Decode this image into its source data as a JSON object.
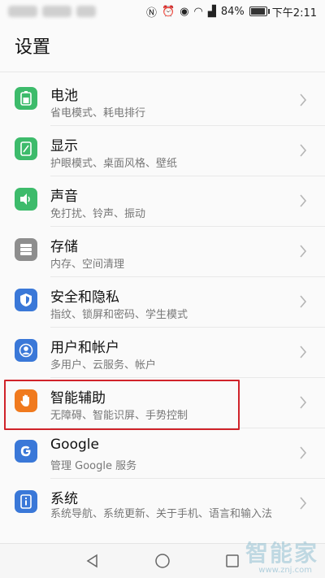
{
  "status_bar": {
    "battery_percent": "84%",
    "time": "下午2:11"
  },
  "page": {
    "title": "设置"
  },
  "items": [
    {
      "title": "电池",
      "subtitle": "省电模式、耗电排行",
      "icon": "battery-icon",
      "color": "#3dbb6b"
    },
    {
      "title": "显示",
      "subtitle": "护眼模式、桌面风格、壁纸",
      "icon": "display-icon",
      "color": "#3dbb6b"
    },
    {
      "title": "声音",
      "subtitle": "免打扰、铃声、振动",
      "icon": "speaker-icon",
      "color": "#3dbb6b"
    },
    {
      "title": "存储",
      "subtitle": "内存、空间清理",
      "icon": "storage-icon",
      "color": "#8e8e8e"
    },
    {
      "title": "安全和隐私",
      "subtitle": "指纹、锁屏和密码、学生模式",
      "icon": "shield-icon",
      "color": "#3a78d8"
    },
    {
      "title": "用户和帐户",
      "subtitle": "多用户、云服务、帐户",
      "icon": "user-icon",
      "color": "#3a78d8"
    },
    {
      "title": "智能辅助",
      "subtitle": "无障碍、智能识屏、手势控制",
      "icon": "hand-icon",
      "color": "#f07a1e"
    },
    {
      "title": "Google",
      "subtitle": "管理 Google 服务",
      "icon": "google-icon",
      "color": "#3a78d8"
    },
    {
      "title": "系统",
      "subtitle": "系统导航、系统更新、关于手机、语言和输入法",
      "icon": "system-info-icon",
      "color": "#3a78d8"
    }
  ],
  "watermark": {
    "text": "智能家",
    "sub": "www.znj.com"
  }
}
